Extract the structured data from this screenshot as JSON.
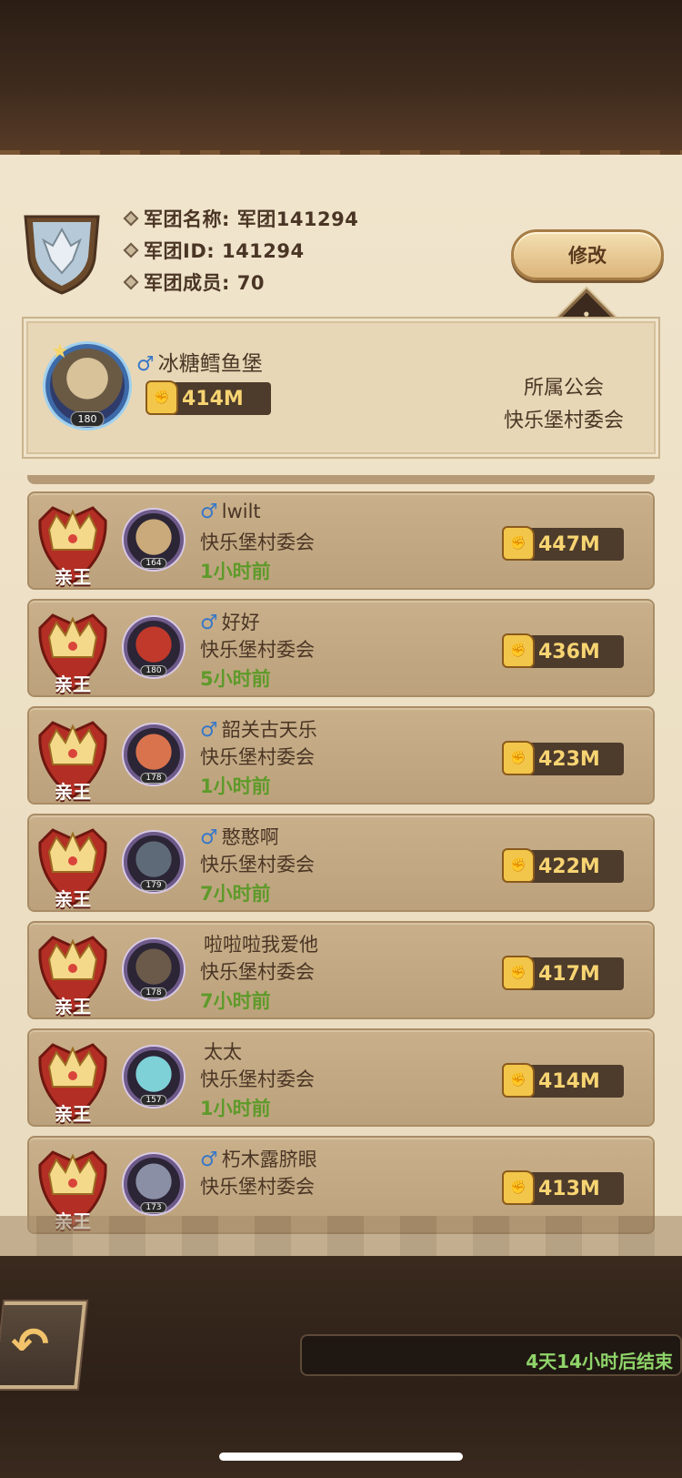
{
  "guild": {
    "name_line": "军团名称: 军团141294",
    "id_line": "军团ID: 141294",
    "members_line": "军团成员: 70",
    "modify_label": "修改",
    "info_glyph": "i"
  },
  "leader": {
    "gender": "♂",
    "name": "冰糖鳕鱼堡",
    "level": "180",
    "power": "414M",
    "guild_label": "所属公会",
    "guild_name": "快乐堡村委会"
  },
  "members": [
    {
      "rank": "亲王",
      "gender": "♂",
      "name": "lwilt",
      "guild": "快乐堡村委会",
      "time": "1小时前",
      "level": "164",
      "power": "447M"
    },
    {
      "rank": "亲王",
      "gender": "♂",
      "name": "好好",
      "guild": "快乐堡村委会",
      "time": "5小时前",
      "level": "180",
      "power": "436M"
    },
    {
      "rank": "亲王",
      "gender": "♂",
      "name": "韶关古天乐",
      "guild": "快乐堡村委会",
      "time": "1小时前",
      "level": "178",
      "power": "423M"
    },
    {
      "rank": "亲王",
      "gender": "♂",
      "name": "憨憨啊",
      "guild": "快乐堡村委会",
      "time": "7小时前",
      "level": "179",
      "power": "422M"
    },
    {
      "rank": "亲王",
      "gender": "",
      "name": "啦啦啦我爱他",
      "guild": "快乐堡村委会",
      "time": "7小时前",
      "level": "178",
      "power": "417M"
    },
    {
      "rank": "亲王",
      "gender": "",
      "name": "太太",
      "guild": "快乐堡村委会",
      "time": "1小时前",
      "level": "157",
      "power": "414M"
    },
    {
      "rank": "亲王",
      "gender": "♂",
      "name": "朽木露脐眼",
      "guild": "快乐堡村委会",
      "time": "",
      "level": "173",
      "power": "413M"
    }
  ],
  "footer": {
    "back_glyph": "↶",
    "timer": "4天14小时后结束"
  },
  "colors": {
    "parchment": "#f0e4cc",
    "row": "#c9b08a",
    "power_text": "#f7d472",
    "time_green": "#5e9a2a",
    "timer_green": "#8fd46a"
  }
}
